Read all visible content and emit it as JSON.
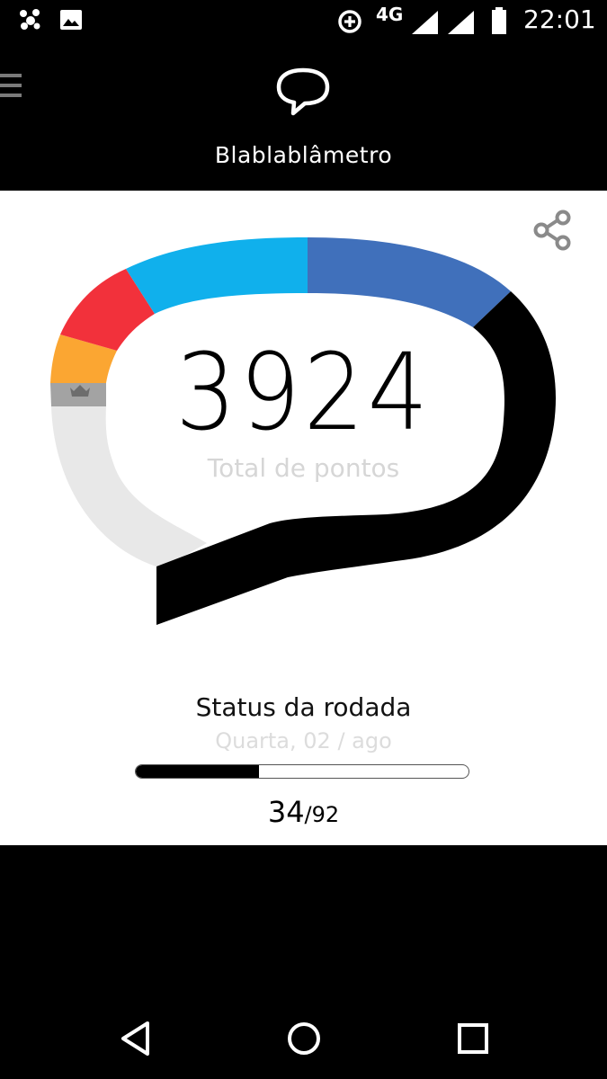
{
  "status_bar": {
    "time": "22:01",
    "network": "4G",
    "icons": [
      "notification-app-icon",
      "image-icon",
      "data-saver-icon",
      "signal-icon",
      "signal-icon",
      "battery-icon"
    ]
  },
  "app_bar": {
    "title": "Blablablâmetro",
    "icons": [
      "menu-icon",
      "speech-bubble-icon"
    ]
  },
  "meter": {
    "score": "3924",
    "score_label": "Total de pontos",
    "icons": [
      "share-icon",
      "crown-icon"
    ],
    "segment_colors": {
      "gray_light": "#e8e8e8",
      "gray_dark": "#a3a3a3",
      "orange": "#fba632",
      "red": "#f2313b",
      "light_blue": "#10b0ec",
      "blue": "#4070bb",
      "black": "#000000"
    }
  },
  "round_status": {
    "title": "Status da rodada",
    "date": "Quarta, 02 / ago",
    "current": "34",
    "total": "/92",
    "progress_fraction": 0.37
  },
  "nav_bar": {
    "icons": [
      "back-icon",
      "home-icon",
      "recents-icon"
    ]
  }
}
